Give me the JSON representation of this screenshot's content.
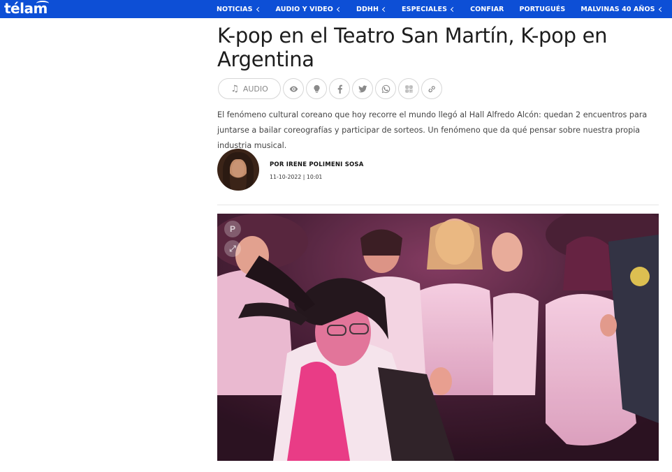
{
  "brand": {
    "logo_text": "télam"
  },
  "nav": {
    "items": [
      {
        "label": "NOTICIAS",
        "dropdown": true
      },
      {
        "label": "AUDIO Y VIDEO",
        "dropdown": true
      },
      {
        "label": "DDHH",
        "dropdown": true
      },
      {
        "label": "ESPECIALES",
        "dropdown": true
      },
      {
        "label": "CONFIAR",
        "dropdown": false
      },
      {
        "label": "PORTUGUÉS",
        "dropdown": false
      },
      {
        "label": "MALVINAS 40 AÑOS",
        "dropdown": true
      }
    ]
  },
  "article": {
    "title": "K-pop en el Teatro San Martín, K-pop en Argentina",
    "lead": "El fenómeno cultural coreano que hoy recorre el mundo llegó al Hall Alfredo Alcón: quedan 2 encuentros para juntarse a bailar coreografías y participar de sorteos. Un fenómeno que da qué pensar sobre nuestra propia industria musical.",
    "author": "POR IRENE POLIMENI SOSA",
    "date": "11-10-2022 | 10:01"
  },
  "share": {
    "audio_label": "AUDIO",
    "icons": [
      "eye-icon",
      "lightbulb-icon",
      "facebook-icon",
      "twitter-icon",
      "whatsapp-icon",
      "qr-code-icon",
      "link-icon"
    ]
  },
  "colors": {
    "nav_bg": "#0d4fd6",
    "title": "#1c1c1c",
    "icon_gray": "#8a8a8a"
  }
}
